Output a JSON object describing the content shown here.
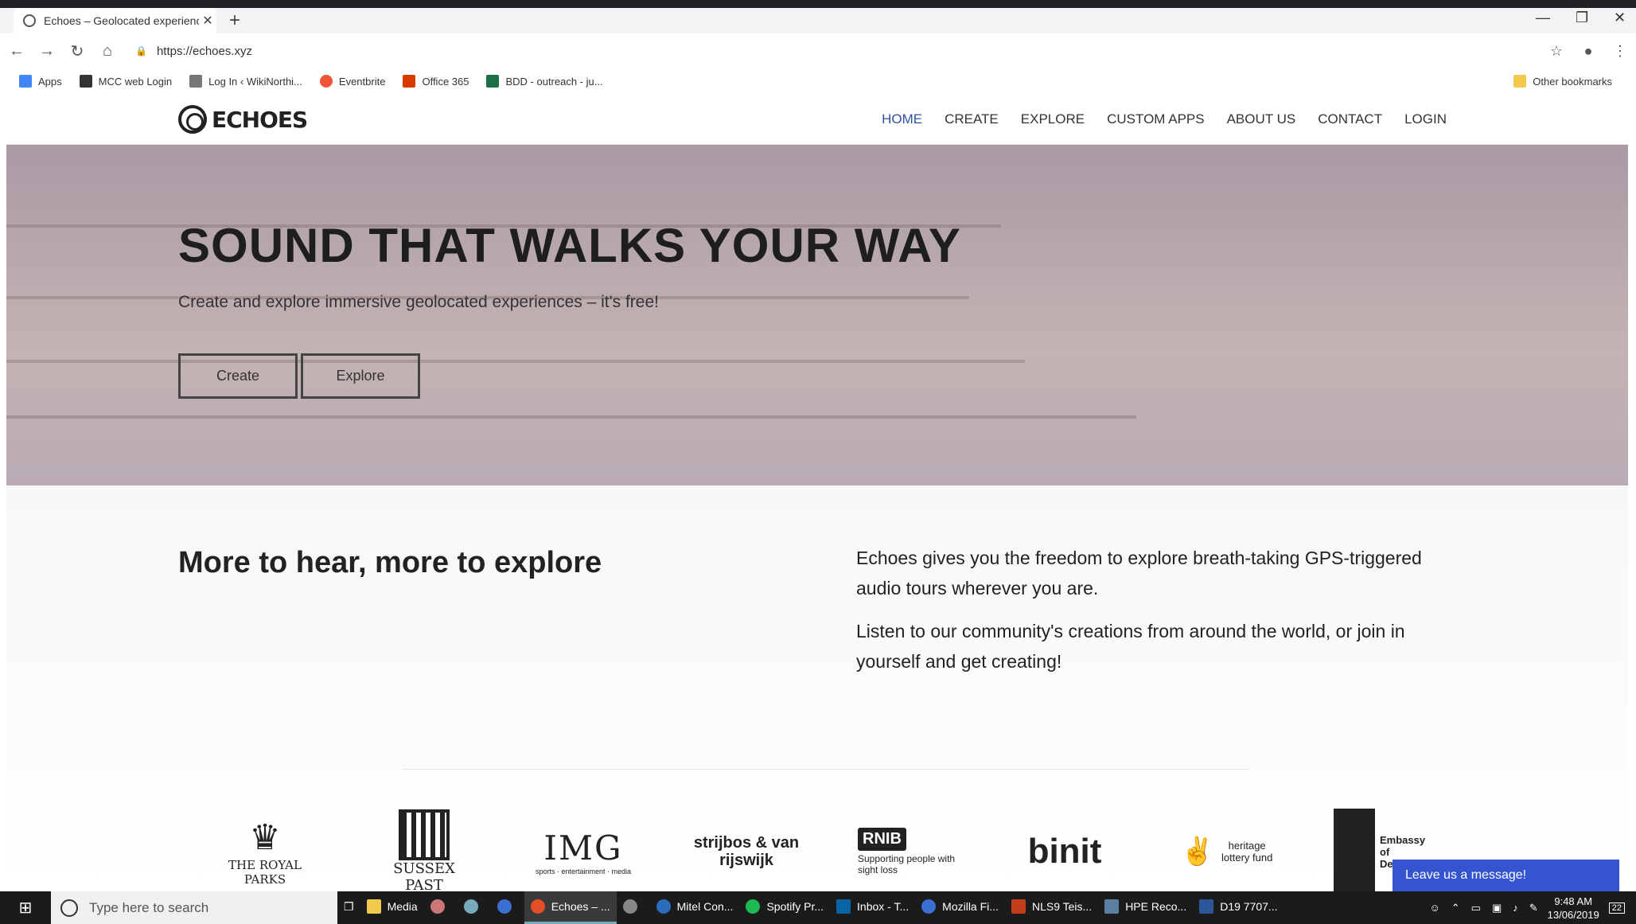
{
  "browser": {
    "tab_title": "Echoes – Geolocated experiences",
    "tab_close": "✕",
    "new_tab": "+",
    "url": "https://echoes.xyz",
    "window_controls": [
      "—",
      "❐",
      "✕"
    ],
    "bookmarks": [
      {
        "label": "Apps",
        "color": "#4285f4"
      },
      {
        "label": "MCC web Login",
        "color": "#333333"
      },
      {
        "label": "Log In ‹ WikiNorthi...",
        "color": "#777777"
      },
      {
        "label": "Eventbrite",
        "color": "#f05537"
      },
      {
        "label": "Office 365",
        "color": "#d83b01"
      },
      {
        "label": "BDD - outreach - ju...",
        "color": "#1d7044"
      }
    ],
    "other_bookmarks": "Other bookmarks"
  },
  "site": {
    "logo_text": "ECHOES",
    "nav": [
      {
        "label": "HOME",
        "active": true
      },
      {
        "label": "CREATE"
      },
      {
        "label": "EXPLORE"
      },
      {
        "label": "CUSTOM APPS"
      },
      {
        "label": "ABOUT US"
      },
      {
        "label": "CONTACT"
      },
      {
        "label": "LOGIN"
      }
    ],
    "accent_color": "#2f4fa0"
  },
  "hero": {
    "title": "SOUND THAT WALKS YOUR WAY",
    "subtitle": "Create and explore immersive geolocated experiences – it's free!",
    "create_button": "Create",
    "explore_button": "Explore"
  },
  "intro": {
    "heading": "More to hear, more to explore",
    "para1": "Echoes gives you the freedom to explore breath-taking GPS-triggered audio tours wherever you are.",
    "para2": "Listen to our community's creations from around the world, or join in yourself and get creating!"
  },
  "partners": {
    "royal_parks": "THE ROYAL PARKS",
    "sussex_past": "SUSSEX PAST",
    "img": "IMG",
    "img_sub": "sports · entertainment · media",
    "strijbos": "strijbos & van rijswijk",
    "rnib": "RNIB",
    "rnib_sub": "Supporting people with sight loss",
    "binit": "binit",
    "heritage": "heritage lottery fund",
    "embassy": "Embassy of Denmark"
  },
  "chat": {
    "label": "Leave us a message!"
  },
  "taskbar": {
    "search_placeholder": "Type here to search",
    "apps": [
      {
        "label": "Media",
        "color": "#f2c94c"
      },
      {
        "label": "Echoes – ...",
        "color": "#e34f26",
        "active": true
      },
      {
        "label": "Mitel Con...",
        "color": "#2a6ebb"
      },
      {
        "label": "Spotify Pr...",
        "color": "#1db954"
      },
      {
        "label": "Inbox - T...",
        "color": "#0a64a4"
      },
      {
        "label": "Mozilla Fi...",
        "color": "#3b6fd1"
      },
      {
        "label": "NLS9 Teis...",
        "color": "#c43e1c"
      },
      {
        "label": "HPE Reco...",
        "color": "#5a7fa3"
      },
      {
        "label": "D19 7707...",
        "color": "#2b579a"
      }
    ],
    "time": "9:48 AM",
    "date": "13/06/2019",
    "notifications": "22"
  }
}
